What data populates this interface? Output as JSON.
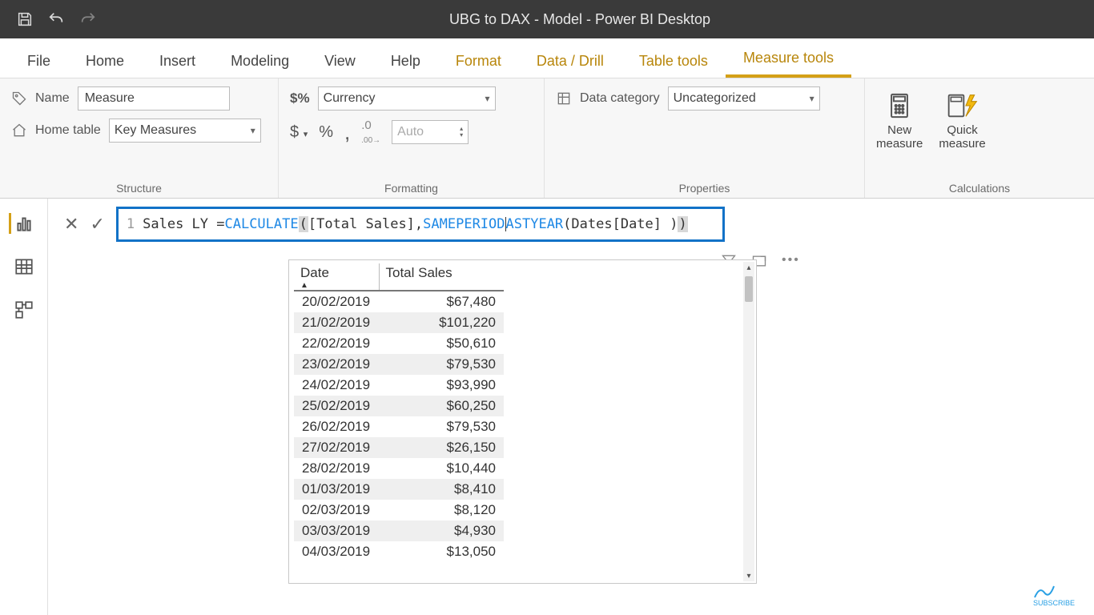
{
  "window_title": "UBG to DAX - Model - Power BI Desktop",
  "ribbon_tabs": [
    "File",
    "Home",
    "Insert",
    "Modeling",
    "View",
    "Help",
    "Format",
    "Data / Drill",
    "Table tools",
    "Measure tools"
  ],
  "structure": {
    "name_label": "Name",
    "name_value": "Measure",
    "home_table_label": "Home table",
    "home_table_value": "Key Measures",
    "group_label": "Structure"
  },
  "formatting": {
    "format_value": "Currency",
    "auto_label": "Auto",
    "group_label": "Formatting"
  },
  "properties": {
    "data_category_label": "Data category",
    "data_category_value": "Uncategorized",
    "group_label": "Properties"
  },
  "calculations": {
    "new_measure": "New measure",
    "quick_measure": "Quick measure",
    "group_label": "Calculations"
  },
  "formula": {
    "line_no": "1",
    "lhs": "Sales LY = ",
    "calc": "CALCULATE",
    "open1": "(",
    "arg1": " [Total Sales], ",
    "sply_a": "SAMEPERIOD",
    "sply_b": "ASTYEAR",
    "open2": "(",
    "arg2": " Dates[Date] ) ",
    "close": ")"
  },
  "chart_data": {
    "type": "table",
    "columns": [
      "Date",
      "Total Sales"
    ],
    "rows": [
      [
        "20/02/2019",
        "$67,480"
      ],
      [
        "21/02/2019",
        "$101,220"
      ],
      [
        "22/02/2019",
        "$50,610"
      ],
      [
        "23/02/2019",
        "$79,530"
      ],
      [
        "24/02/2019",
        "$93,990"
      ],
      [
        "25/02/2019",
        "$60,250"
      ],
      [
        "26/02/2019",
        "$79,530"
      ],
      [
        "27/02/2019",
        "$26,150"
      ],
      [
        "28/02/2019",
        "$10,440"
      ],
      [
        "01/03/2019",
        "$8,410"
      ],
      [
        "02/03/2019",
        "$8,120"
      ],
      [
        "03/03/2019",
        "$4,930"
      ],
      [
        "04/03/2019",
        "$13,050"
      ]
    ]
  },
  "brand": "SUBSCRIBE"
}
